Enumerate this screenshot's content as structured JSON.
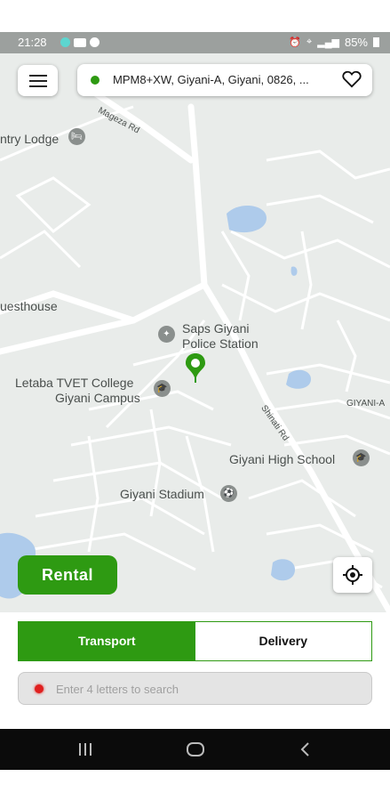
{
  "status_bar": {
    "time": "21:28",
    "battery": "85%"
  },
  "top_bar": {
    "menu_icon": "hamburger-menu-icon",
    "address": "MPM8+XW, Giyani-A, Giyani, 0826, ...",
    "favorite_icon": "heart-icon"
  },
  "map": {
    "labels": {
      "lodge": "ntry Lodge",
      "guesthouse": "uesthouse",
      "police": "Saps Giyani\nPolice Station",
      "police_line1": "Saps Giyani",
      "police_line2": "Police Station",
      "college_line1": "Letaba TVET College",
      "college_line2": "Giyani Campus",
      "high_school": "Giyani High School",
      "stadium": "Giyani Stadium",
      "area": "GIYANI-A",
      "road_mageza": "Mageza Rd",
      "road_shinati": "Shinati Rd"
    }
  },
  "actions": {
    "rental_label": "Rental",
    "locate_icon": "my-location-icon"
  },
  "mode_tabs": {
    "transport": "Transport",
    "delivery": "Delivery",
    "selected": "Transport"
  },
  "search": {
    "placeholder": "Enter 4 letters to search",
    "value": ""
  },
  "colors": {
    "brand_green": "#2e9a12",
    "pin_red": "#e0201f"
  },
  "nav_bar": {
    "recent_icon": "recent-apps-icon",
    "home_icon": "home-icon",
    "back_icon": "back-icon"
  }
}
